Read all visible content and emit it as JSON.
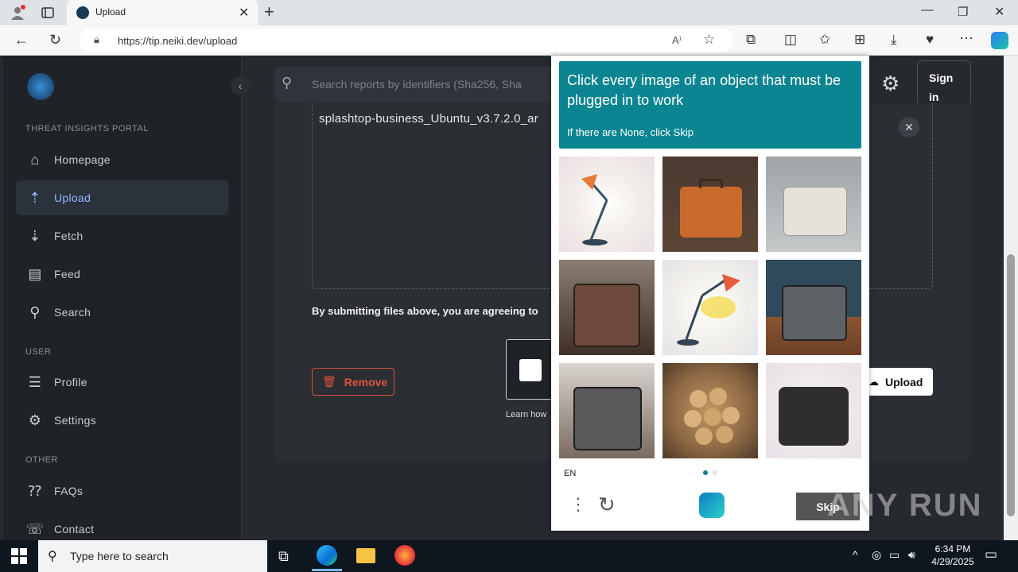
{
  "browser": {
    "tab_title": "Upload",
    "url": "https://tip.neiki.dev/upload",
    "new_tab": "+",
    "read_aloud": "A⁾"
  },
  "sidebar": {
    "portal_label": "THREAT INSIGHTS PORTAL",
    "items": [
      {
        "label": "Homepage",
        "icon": "home-icon"
      },
      {
        "label": "Upload",
        "icon": "upload-icon"
      },
      {
        "label": "Fetch",
        "icon": "download-icon"
      },
      {
        "label": "Feed",
        "icon": "feed-icon"
      },
      {
        "label": "Search",
        "icon": "search-icon"
      }
    ],
    "user_label": "USER",
    "user_items": [
      {
        "label": "Profile",
        "icon": "profile-icon"
      },
      {
        "label": "Settings",
        "icon": "gear-icon"
      }
    ],
    "other_label": "OTHER",
    "other_items": [
      {
        "label": "FAQs",
        "icon": "faq-icon"
      },
      {
        "label": "Contact",
        "icon": "contact-icon"
      }
    ]
  },
  "header": {
    "search_placeholder": "Search reports by identifiers (Sha256, Sha",
    "signin_line1": "Sign",
    "signin_line2": "in"
  },
  "main": {
    "filename": "splashtop-business_Ubuntu_v3.7.2.0_ar",
    "agreement": "By submitting files above, you are agreeing to",
    "remove_label": "Remove",
    "upload_label": "Upload",
    "learn_how": "Learn how"
  },
  "captcha": {
    "prompt": "Click every image of an object that must be plugged in to work",
    "hint": "If there are None, click Skip",
    "tiles": [
      "desk-lamp",
      "suitcase",
      "suitcase",
      "suitcase",
      "desk-lamp",
      "suitcase",
      "suitcase",
      "nuts-basket",
      "suitcase"
    ],
    "language": "EN",
    "skip_label": "Skip"
  },
  "watermark": "ANY RUN",
  "taskbar": {
    "search_placeholder": "Type here to search",
    "time": "6:34 PM",
    "date": "4/29/2025"
  },
  "colors": {
    "accent": "#0a8591",
    "remove": "#e0533f",
    "active_nav": "#8fb8ff"
  }
}
